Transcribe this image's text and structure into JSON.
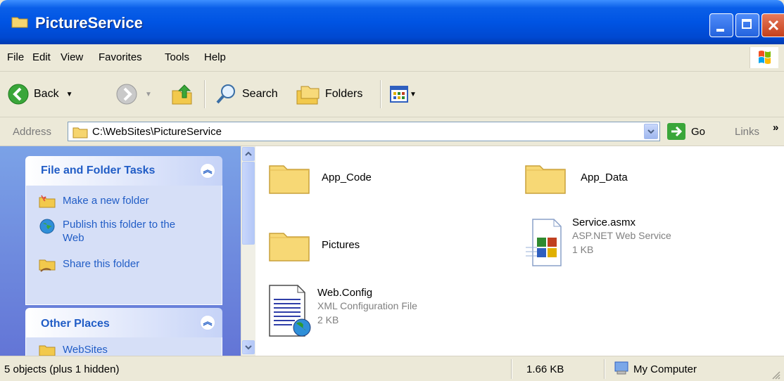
{
  "window": {
    "title": "PictureService"
  },
  "menu": {
    "items": [
      {
        "label": "File"
      },
      {
        "label": "Edit"
      },
      {
        "label": "View"
      },
      {
        "label": "Favorites"
      },
      {
        "label": "Tools"
      },
      {
        "label": "Help"
      }
    ]
  },
  "toolbar": {
    "back_label": "Back",
    "search_label": "Search",
    "folders_label": "Folders"
  },
  "address": {
    "label": "Address",
    "path": "C:\\WebSites\\PictureService",
    "go_label": "Go",
    "links_label": "Links"
  },
  "left_pane": {
    "file_tasks": {
      "title": "File and Folder Tasks",
      "items": [
        {
          "label": "Make a new folder"
        },
        {
          "label": "Publish this folder to the Web"
        },
        {
          "label": "Share this folder"
        }
      ]
    },
    "other_places": {
      "title": "Other Places",
      "items": [
        {
          "label": "WebSites"
        }
      ]
    }
  },
  "files": [
    {
      "name": "App_Code",
      "type": "folder"
    },
    {
      "name": "App_Data",
      "type": "folder"
    },
    {
      "name": "Pictures",
      "type": "folder"
    },
    {
      "name": "Service.asmx",
      "type_label": "ASP.NET Web Service",
      "size": "1 KB"
    },
    {
      "name": "Web.Config",
      "type_label": "XML Configuration File",
      "size": "2 KB"
    }
  ],
  "status": {
    "objects": "5 objects (plus 1 hidden)",
    "size": "1.66 KB",
    "location": "My Computer"
  },
  "colors": {
    "titlebar": "#0054e3",
    "task_link": "#215dc6",
    "left_pane": "#7ba2e7"
  }
}
